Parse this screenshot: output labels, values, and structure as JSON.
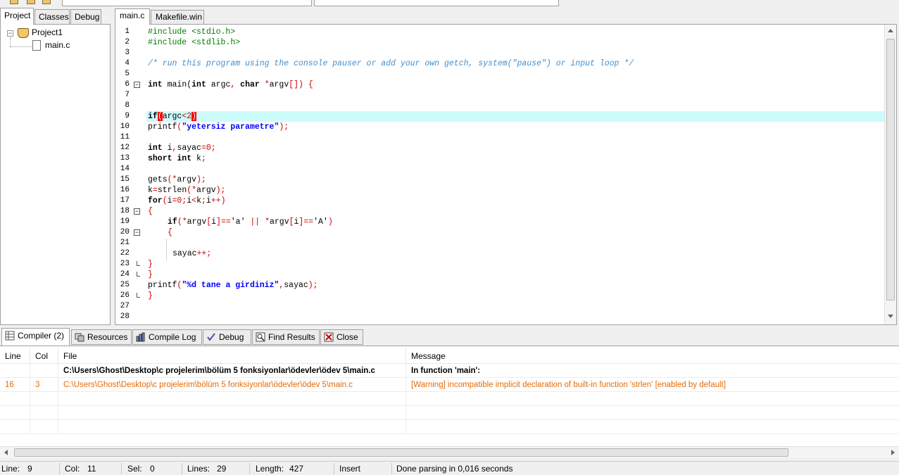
{
  "left_tabs": [
    "Project",
    "Classes",
    "Debug"
  ],
  "tree": {
    "project": "Project1",
    "file": "main.c"
  },
  "editor_tabs": [
    "main.c",
    "Makefile.win"
  ],
  "code": {
    "line_numbers": [
      "1",
      "2",
      "3",
      "4",
      "5",
      "6",
      "7",
      "8",
      "9",
      "10",
      "11",
      "12",
      "13",
      "14",
      "15",
      "16",
      "17",
      "18",
      "19",
      "20",
      "21",
      "22",
      "23",
      "24",
      "25",
      "26",
      "27",
      "28"
    ],
    "l1": "#include <stdio.h>",
    "l2": "#include <stdlib.h>",
    "l4": "/* run this program using the console pauser or add your own getch, system(\"pause\") or input loop */",
    "l6a": "int",
    "l6b": " main(",
    "l6c": "int",
    "l6d": " argc",
    "l6e": ",",
    "l6f": " char",
    "l6g": " ",
    "l6h": "*",
    "l6i": "argv",
    "l6j": "[])",
    "l6k": " {",
    "l9a": "if",
    "l9b": "(",
    "l9c": "argc",
    "l9d": "<2",
    "l9e": ")",
    "l10a": "printf",
    "l10b": "(",
    "l10c": "\"yetersiz parametre\"",
    "l10d": ");",
    "l12a": "int",
    "l12b": " i",
    "l12c": ",",
    "l12d": "sayac",
    "l12e": "=0;",
    "l13a": "short int",
    "l13b": " k",
    "l13c": ";",
    "l15a": "gets",
    "l15b": "(*",
    "l15c": "argv",
    "l15d": ");",
    "l16a": "k",
    "l16b": "=",
    "l16c": "strlen",
    "l16d": "(*",
    "l16e": "argv",
    "l16f": ");",
    "l17a": "for",
    "l17b": "(",
    "l17c": "i",
    "l17d": "=0;",
    "l17e": "i",
    "l17f": "<",
    "l17g": "k",
    "l17h": ";",
    "l17i": "i",
    "l17j": "++)",
    "l18": "{",
    "l19a": "if",
    "l19b": "(*",
    "l19c": "argv",
    "l19d": "[",
    "l19e": "i",
    "l19f": "]==",
    "l19g": "'a'",
    "l19h": " || *",
    "l19i": "argv",
    "l19j": "[",
    "l19k": "i",
    "l19l": "]==",
    "l19m": "'A'",
    "l19n": ")",
    "l20": "{",
    "l22a": "sayac",
    "l22b": "++;",
    "l23": "}",
    "l24": "}",
    "l25a": "printf",
    "l25b": "(",
    "l25c": "\"%d tane a girdiniz\"",
    "l25d": ",",
    "l25e": "sayac",
    "l25f": ");",
    "l26": "}"
  },
  "bottom_tabs": [
    "Compiler (2)",
    "Resources",
    "Compile Log",
    "Debug",
    "Find Results",
    "Close"
  ],
  "messages": {
    "headers": [
      "Line",
      "Col",
      "File",
      "Message"
    ],
    "rows": [
      {
        "line": "",
        "col": "",
        "file": "C:\\Users\\Ghost\\Desktop\\c projelerim\\bölüm 5 fonksiyonlar\\ödevler\\ödev 5\\main.c",
        "message": "In function 'main':"
      },
      {
        "line": "16",
        "col": "3",
        "file": "C:\\Users\\Ghost\\Desktop\\c projelerim\\bölüm 5 fonksiyonlar\\ödevler\\ödev 5\\main.c",
        "message": "[Warning] incompatible implicit declaration of built-in function 'strlen' [enabled by default]"
      }
    ]
  },
  "status": {
    "line_label": "Line:",
    "line_value": "9",
    "col_label": "Col:",
    "col_value": "11",
    "sel_label": "Sel:",
    "sel_value": "0",
    "lines_label": "Lines:",
    "lines_value": "29",
    "length_label": "Length:",
    "length_value": "427",
    "mode": "Insert",
    "message": "Done parsing in 0,016 seconds"
  },
  "colors": {
    "highlight_line": "#cdfbfb",
    "warning": "#e36c09",
    "string": "#0000ff",
    "comment": "#3e8fd0",
    "symbol": "#cc0000"
  }
}
